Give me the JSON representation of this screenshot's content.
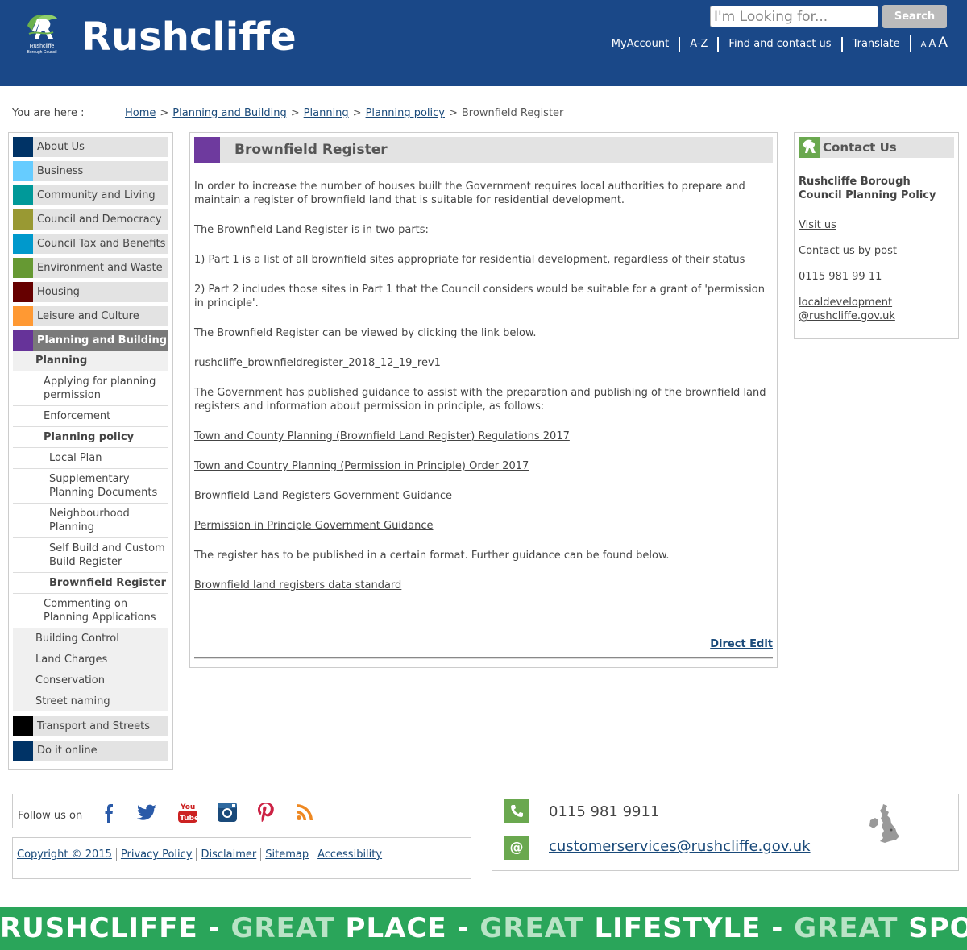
{
  "header": {
    "logo_text": "Rushcliffe",
    "logo_sub_line1": "Rushcliffe",
    "logo_sub_line2": "Borough Council",
    "search_placeholder": "I'm Looking for...",
    "search_button": "Search",
    "nav": [
      "MyAccount",
      "A-Z",
      "Find and contact us",
      "Translate"
    ],
    "font_sizes": [
      "A",
      "A",
      "A"
    ]
  },
  "breadcrumb": {
    "label": "You are here :",
    "items": [
      "Home",
      "Planning and Building",
      "Planning",
      "Planning policy"
    ],
    "separator": ">",
    "current": "Brownfield Register"
  },
  "sidebar": {
    "items": [
      {
        "label": "About Us",
        "color": "#003366"
      },
      {
        "label": "Business",
        "color": "#66ccff"
      },
      {
        "label": "Community and Living",
        "color": "#009999"
      },
      {
        "label": "Council and Democracy",
        "color": "#999933"
      },
      {
        "label": "Council Tax and Benefits",
        "color": "#0099cc"
      },
      {
        "label": "Environment and Waste",
        "color": "#669933"
      },
      {
        "label": "Housing",
        "color": "#660000"
      },
      {
        "label": "Leisure and Culture",
        "color": "#ff9933"
      },
      {
        "label": "Planning and Building",
        "color": "#663399"
      }
    ],
    "planning_label": "Planning",
    "planning_children": [
      "Applying for planning permission",
      "Enforcement",
      "Planning policy"
    ],
    "policy_children": [
      "Local Plan",
      "Supplementary Planning Documents",
      "Neighbourhood Planning",
      "Self Build and Custom Build Register",
      "Brownfield Register"
    ],
    "commenting": "Commenting on Planning Applications",
    "building_children": [
      "Building Control",
      "Land Charges",
      "Conservation",
      "Street naming"
    ],
    "bottom_items": [
      {
        "label": "Transport and Streets",
        "color": "#000000"
      },
      {
        "label": "Do it online",
        "color": "#003366"
      }
    ]
  },
  "main": {
    "title": "Brownfield Register",
    "p1": "In order to increase the number of houses built the Government requires local authorities to prepare and maintain a register of brownfield land that is suitable for residential development.",
    "p2": "The Brownfield Land Register is in two parts:",
    "p3": "1) Part 1 is a list of all brownfield sites appropriate for residential development, regardless of their status",
    "p4": "2) Part 2 includes those sites in Part 1 that the Council considers would be suitable for a grant of 'permission in principle'.",
    "p5": "The Brownfield Register can be viewed by clicking the link below.",
    "link_register": "rushcliffe_brownfieldregister_2018_12_19_rev1",
    "p6": "The Government has published guidance to assist with the preparation and publishing of the brownfield land registers and information about permission in principle, as follows:",
    "link1": "Town and County Planning (Brownfield Land Register) Regulations 2017",
    "link2": "Town and Country Planning (Permission in Principle) Order 2017",
    "link3": "Brownfield Land Registers Government Guidance",
    "link4": "Permission in Principle Government Guidance",
    "p7": "The register has to be published in a certain format.  Further guidance can be found below.",
    "link5": "Brownfield land registers data standard",
    "direct_edit": "Direct Edit"
  },
  "contact": {
    "title": "Contact Us",
    "org": "Rushcliffe Borough Council Planning Policy",
    "visit": "Visit us",
    "post": "Contact us by post",
    "phone": "0115 981 99 11",
    "email_line1": "localdevelopment",
    "email_line2": "@rushcliffe.gov.uk"
  },
  "footer": {
    "follow": "Follow us on",
    "social": [
      "facebook-icon",
      "twitter-icon",
      "youtube-icon",
      "instagram-icon",
      "pinterest-icon",
      "rss-icon"
    ],
    "legal": [
      "Copyright © 2015",
      "Privacy Policy",
      "Disclaimer",
      "Sitemap",
      "Accessibility"
    ],
    "phone": "0115 981 9911",
    "email": "customerservices@rushcliffe.gov.uk",
    "at_symbol": "@"
  },
  "slogan": {
    "w1": "RUSHCLIFFE",
    "dash": "-",
    "great": "GREAT",
    "w2": "PLACE",
    "w3": "LIFESTYLE",
    "w4": "SPORT"
  },
  "colors": {
    "header_bg": "#1a4888",
    "accent_green": "#6aa84f",
    "slogan_bg": "#2aa55a",
    "planning_purple": "#663399"
  }
}
